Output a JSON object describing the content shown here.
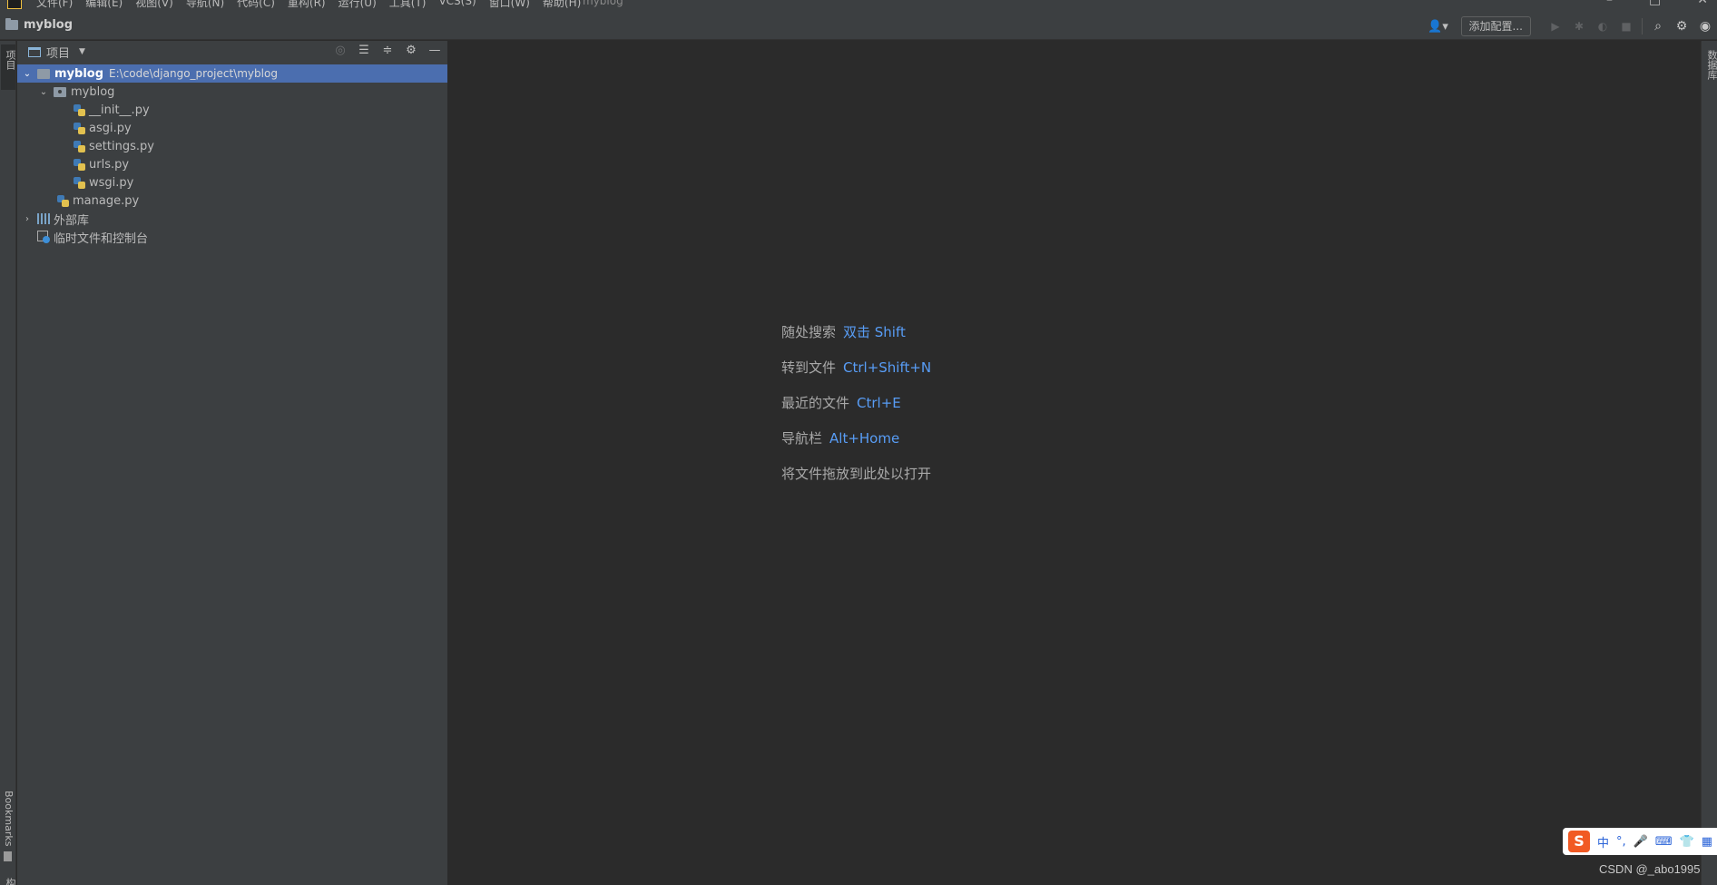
{
  "menubar": {
    "items": [
      "文件(F)",
      "编辑(E)",
      "视图(V)",
      "导航(N)",
      "代码(C)",
      "重构(R)",
      "运行(U)",
      "工具(T)",
      "VCS(S)",
      "窗口(W)",
      "帮助(H)"
    ],
    "title": "myblog"
  },
  "navbar": {
    "project_name": "myblog",
    "add_config_label": "添加配置..."
  },
  "left_stripe": {
    "project_tab": "项目",
    "bookmarks_tab": "Bookmarks",
    "structure_tab": "结构"
  },
  "right_stripe": {
    "tab": "数据库"
  },
  "project_panel": {
    "title": "项目",
    "tree": {
      "root_name": "myblog",
      "root_path": "E:\\code\\django_project\\myblog",
      "package_name": "myblog",
      "files": [
        "__init__.py",
        "asgi.py",
        "settings.py",
        "urls.py",
        "wsgi.py"
      ],
      "manage_file": "manage.py",
      "external_libs": "外部库",
      "scratches": "临时文件和控制台"
    }
  },
  "editor": {
    "hints": [
      {
        "label": "随处搜索",
        "key": "双击 Shift"
      },
      {
        "label": "转到文件",
        "key": "Ctrl+Shift+N"
      },
      {
        "label": "最近的文件",
        "key": "Ctrl+E"
      },
      {
        "label": "导航栏",
        "key": "Alt+Home"
      },
      {
        "label": "将文件拖放到此处以打开",
        "key": ""
      }
    ]
  },
  "ime": {
    "logo": "S",
    "mode": "中"
  },
  "watermark": "CSDN @_abo1995",
  "colors": {
    "selection": "#4b6eaf",
    "shortcut_key": "#589df6",
    "panel_bg": "#3c3f41",
    "editor_bg": "#2b2b2b"
  }
}
